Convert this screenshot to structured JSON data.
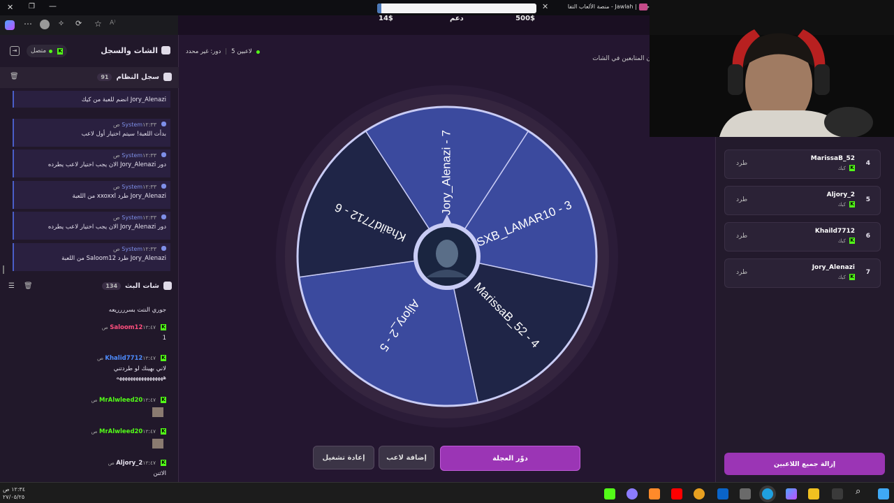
{
  "browser": {
    "tab_title": "جولة | Jawlah - منصة الألعاب التفا",
    "close_tab": "✕"
  },
  "donation": {
    "left_amount": "14$",
    "center_label": "دعم",
    "right_amount": "500$",
    "progress": 0.028
  },
  "sidebar": {
    "title": "الشات والسجل",
    "status": "متصل",
    "system_log": {
      "title": "سجل النظام",
      "count": "91"
    },
    "messages": [
      {
        "who": "",
        "time": "",
        "text": "Jory_Alenazi انضم للعبة من كيك"
      },
      {
        "who": "System",
        "time": "١٢:٣٣ ص",
        "text": "بدأت اللعبة! سيتم اختيار أول لاعب"
      },
      {
        "who": "System",
        "time": "١٢:٣٣ ص",
        "text": "دور Jory_Alenazi الان يجب اختيار لاعب يطرده"
      },
      {
        "who": "System",
        "time": "١٢:٣٣ ص",
        "text": "Jory_Alenazi طرد xxoxxl من اللعبة"
      },
      {
        "who": "System",
        "time": "١٢:٣٣ ص",
        "text": "دور Jory_Alenazi الان يجب اختيار لاعب يطرده"
      },
      {
        "who": "System",
        "time": "١٢:٣٣ ص",
        "text": "Jory_Alenazi طرد Saloom12 من اللعبة"
      }
    ],
    "stream_chat": {
      "title": "شات البث",
      "count": "134"
    },
    "chat": [
      {
        "name": "",
        "time": "",
        "text": "جوري النتت بسرررريعه",
        "color": "#e8e4f0"
      },
      {
        "name": "Saloom12",
        "time": "١٢:٤٧ ص",
        "text": "1",
        "color": "#ff4f7e"
      },
      {
        "name": "Khalid7712",
        "time": "١٢:٤٧ ص",
        "text": "لاني بهينك لو طردتني",
        "text2": "هههههههههههههههههه",
        "color": "#4d8cff"
      },
      {
        "name": "MrAlwleed20",
        "time": "١٢:٤٧ ص",
        "text": "",
        "color": "#53fc18"
      },
      {
        "name": "MrAlwleed20",
        "time": "١٢:٤٧ ص",
        "text": "",
        "color": "#53fc18"
      },
      {
        "name": "Aljory_2",
        "time": "١٢:٤٧ ص",
        "text": "الاثنن",
        "color": "#e8e4f0"
      }
    ]
  },
  "main": {
    "players_count": "5 لاعبين",
    "turn": "دور: غير محدد",
    "followers_hint": "ن المتابعين في الشات",
    "wheel": {
      "segments": [
        {
          "label": "Jory_Alenazi - 7",
          "color": "#3b4a9e"
        },
        {
          "label": "SXB_LAMAR10 - 3",
          "color": "#3b4a9e"
        },
        {
          "label": "MarissaB_52 - 4",
          "color": "#1f2547"
        },
        {
          "label": "Aljory_2 - 5",
          "color": "#3b4a9e"
        },
        {
          "label": "Khaild7712 - 6",
          "color": "#1f2547"
        }
      ]
    },
    "buttons": {
      "spin": "دوّر العجلة",
      "add": "إضافة لاعب",
      "restart": "إعادة تشغيل"
    }
  },
  "players": [
    {
      "num": "4",
      "name": "MarissaB_52",
      "platform": "كيك",
      "kick": "طرد"
    },
    {
      "num": "5",
      "name": "Aljory_2",
      "platform": "كيك",
      "kick": "طرد"
    },
    {
      "num": "6",
      "name": "Khaild7712",
      "platform": "كيك",
      "kick": "طرد"
    },
    {
      "num": "7",
      "name": "Jory_Alenazi",
      "platform": "كيك",
      "kick": "طرد"
    }
  ],
  "remove_all": "إزالة جميع اللاعبين",
  "taskbar": {
    "time": "١٢:٣٤ ص",
    "date": "٢٧/٠٥/٢٥"
  }
}
